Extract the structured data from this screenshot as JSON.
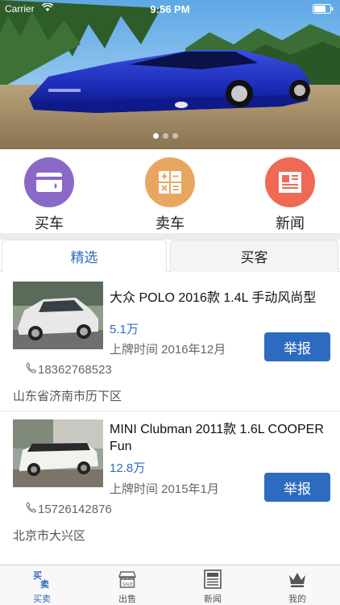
{
  "status_bar": {
    "carrier": "Carrier",
    "time": "9:56 PM"
  },
  "banner": {
    "slides": 3,
    "active_slide": 1
  },
  "categories": [
    {
      "label": "买车",
      "icon": "credit-card-icon",
      "color": "#8a68c8"
    },
    {
      "label": "卖车",
      "icon": "calculator-icon",
      "color": "#e9a660"
    },
    {
      "label": "新闻",
      "icon": "newspaper-icon",
      "color": "#ee6a55"
    }
  ],
  "tabs": [
    {
      "label": "精选",
      "active": true
    },
    {
      "label": "买客",
      "active": false
    }
  ],
  "listings": [
    {
      "title": "大众 POLO 2016款 1.4L 手动风尚型",
      "price": "5.1万",
      "reg_date": "上牌时间 2016年12月",
      "report_label": "举报",
      "phone": "18362768523",
      "address": "山东省济南市历下区"
    },
    {
      "title": "MINI Clubman 2011款 1.6L COOPER Fun",
      "price": "12.8万",
      "reg_date": "上牌时间 2015年1月",
      "report_label": "举报",
      "phone": "15726142876",
      "address": "北京市大兴区"
    }
  ],
  "tabbar": [
    {
      "label": "买卖",
      "icon": "buy-sell-icon",
      "active": true
    },
    {
      "label": "出售",
      "icon": "shop-icon",
      "active": false
    },
    {
      "label": "新闻",
      "icon": "news-icon",
      "active": false
    },
    {
      "label": "我的",
      "icon": "crown-icon",
      "active": false
    }
  ],
  "colors": {
    "accent": "#2d6bc0",
    "report_button": "#2d6bc0"
  }
}
